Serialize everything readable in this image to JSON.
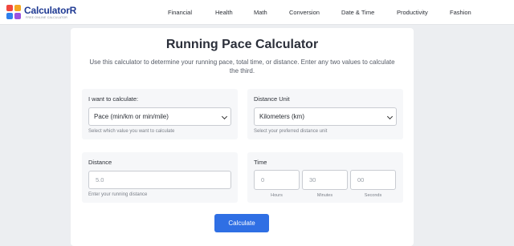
{
  "header": {
    "logo_name": "CalculatorR",
    "logo_tagline": "FREE ONLINE CALCULATOR",
    "nav": [
      "Financial",
      "Health",
      "Math",
      "Conversion",
      "Date & Time",
      "Productivity",
      "Fashion"
    ]
  },
  "page": {
    "title": "Running Pace Calculator",
    "description": "Use this calculator to determine your running pace, total time, or distance. Enter any two values to calculate the third."
  },
  "calculate_mode": {
    "label": "I want to calculate:",
    "selected": "Pace (min/km or min/mile)",
    "help": "Select which value you want to calculate"
  },
  "distance_unit": {
    "label": "Distance Unit",
    "selected": "Kilometers (km)",
    "help": "Select your preferred distance unit"
  },
  "distance": {
    "label": "Distance",
    "placeholder": "5.0",
    "help": "Enter your running distance"
  },
  "time": {
    "label": "Time",
    "hours_placeholder": "0",
    "minutes_placeholder": "30",
    "seconds_placeholder": "00",
    "hours_label": "Hours",
    "minutes_label": "Minutes",
    "seconds_label": "Seconds"
  },
  "calculate_button": "Calculate",
  "colors": {
    "accent": "#2f6fe4",
    "brand": "#1f3a93"
  }
}
